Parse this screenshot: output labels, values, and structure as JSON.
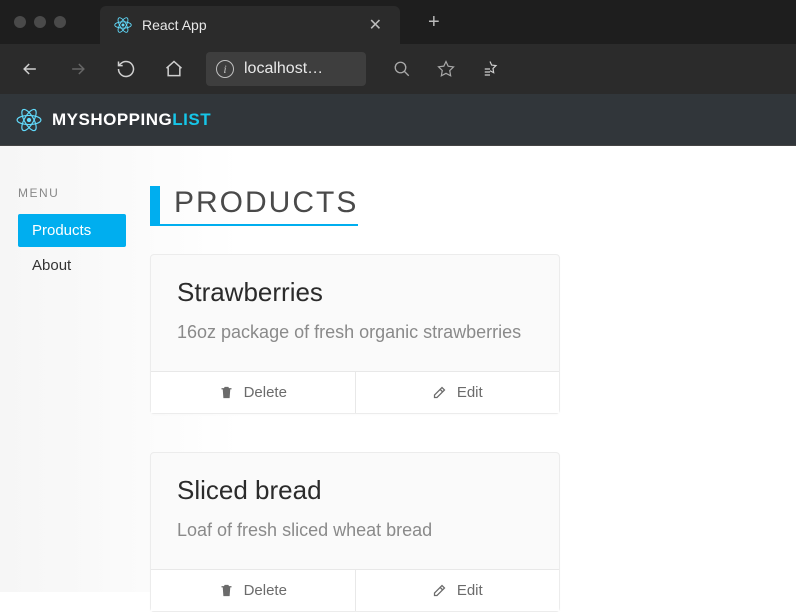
{
  "browser": {
    "tab_title": "React App",
    "address": "localhost…"
  },
  "brand": {
    "my": "MY",
    "shopping": "SHOPPING",
    "list": "LIST"
  },
  "sidebar": {
    "menu_label": "MENU",
    "items": [
      {
        "label": "Products",
        "active": true
      },
      {
        "label": "About",
        "active": false
      }
    ]
  },
  "page": {
    "title": "PRODUCTS"
  },
  "products": [
    {
      "name": "Strawberries",
      "description": "16oz package of fresh organic strawberries",
      "delete_label": "Delete",
      "edit_label": "Edit"
    },
    {
      "name": "Sliced bread",
      "description": "Loaf of fresh sliced wheat bread",
      "delete_label": "Delete",
      "edit_label": "Edit"
    }
  ],
  "colors": {
    "accent": "#00aeef",
    "header_bg": "#31363a",
    "brand_accent": "#16c6e8"
  }
}
